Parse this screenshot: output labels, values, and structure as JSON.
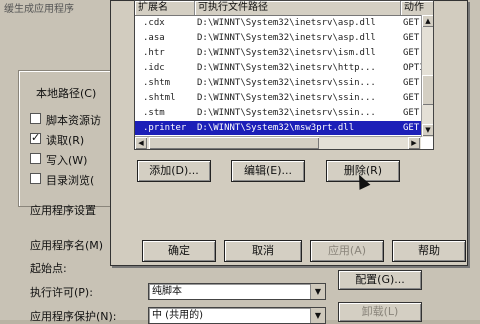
{
  "background": {
    "title_fragment": "缓生成应用程序",
    "group_label": "本地路径(C)",
    "checkboxes": [
      {
        "label": "脚本资源访",
        "checked": false
      },
      {
        "label": "读取(R)",
        "checked": true
      },
      {
        "label": "写入(W)",
        "checked": false
      },
      {
        "label": "目录浏览(",
        "checked": false
      }
    ],
    "app_settings_label": "应用程序设置",
    "app_name_label": "应用程序名(M)",
    "start_point_label": "起始点:",
    "exec_perm_label": "执行许可(P):",
    "exec_perm_value": "纯脚本",
    "app_protect_label": "应用程序保护(N):",
    "app_protect_value": "中 (共用的)",
    "config_button": "配置(G)...",
    "unload_button": "卸载(L)"
  },
  "mapping": {
    "headers": [
      "扩展名",
      "可执行文件路径",
      "动作"
    ],
    "rows": [
      {
        "ext": ".cdx",
        "path": "D:\\WINNT\\System32\\inetsrv\\asp.dll",
        "verb": "GET,"
      },
      {
        "ext": ".asa",
        "path": "D:\\WINNT\\System32\\inetsrv\\asp.dll",
        "verb": "GET,"
      },
      {
        "ext": ".htr",
        "path": "D:\\WINNT\\System32\\inetsrv\\ism.dll",
        "verb": "GET,"
      },
      {
        "ext": ".idc",
        "path": "D:\\WINNT\\System32\\inetsrv\\http...",
        "verb": "OPTI"
      },
      {
        "ext": ".shtm",
        "path": "D:\\WINNT\\System32\\inetsrv\\ssin...",
        "verb": "GET,"
      },
      {
        "ext": ".shtml",
        "path": "D:\\WINNT\\System32\\inetsrv\\ssin...",
        "verb": "GET,"
      },
      {
        "ext": ".stm",
        "path": "D:\\WINNT\\System32\\inetsrv\\ssin...",
        "verb": "GET,"
      },
      {
        "ext": ".printer",
        "path": "D:\\WINNT\\System32\\msw3prt.dll",
        "verb": "GET"
      }
    ],
    "buttons": {
      "add": "添加(D)...",
      "edit": "编辑(E)...",
      "remove": "删除(R)"
    }
  },
  "footer": {
    "ok": "确定",
    "cancel": "取消",
    "apply": "应用(A)",
    "help": "帮助"
  }
}
